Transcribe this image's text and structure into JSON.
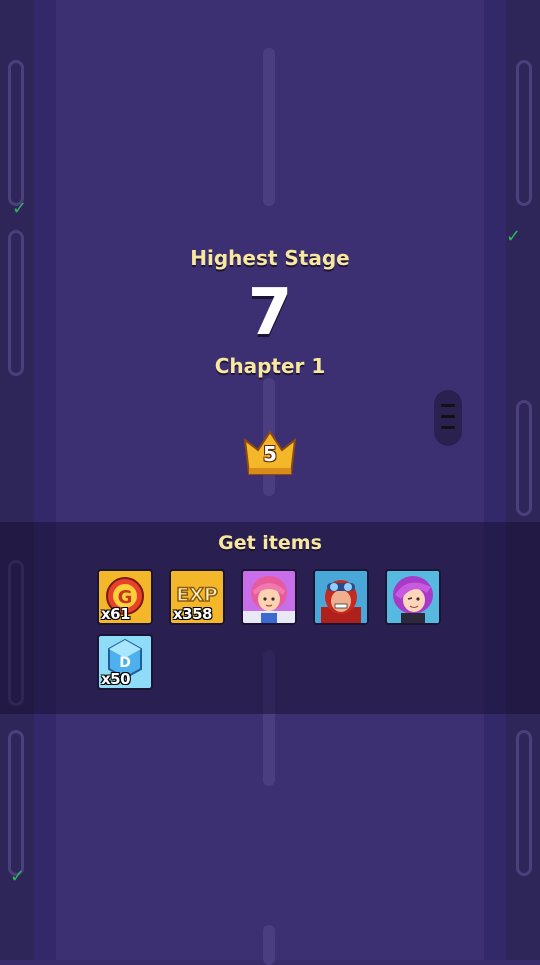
{
  "stage": {
    "heading": "Highest Stage",
    "number": "7",
    "chapter": "Chapter 1"
  },
  "crown": {
    "level": "5"
  },
  "rewards": {
    "title": "Get items",
    "items": [
      {
        "icon": "gold-coin-icon",
        "quantity": "x61"
      },
      {
        "icon": "exp-icon",
        "quantity": "x358"
      },
      {
        "icon": "pink-hair-hero-portrait",
        "quantity": ""
      },
      {
        "icon": "red-goggles-hero-portrait",
        "quantity": ""
      },
      {
        "icon": "purple-hair-hero-portrait",
        "quantity": ""
      },
      {
        "icon": "diamond-gem-icon",
        "quantity": "x50"
      }
    ]
  },
  "colors": {
    "background": "#3a2d6b",
    "title_text": "#f7e7a0",
    "gold_frame": "#f5b72a",
    "purple_frame": "#c76ee8",
    "blue_frame": "#6fd3f5"
  }
}
